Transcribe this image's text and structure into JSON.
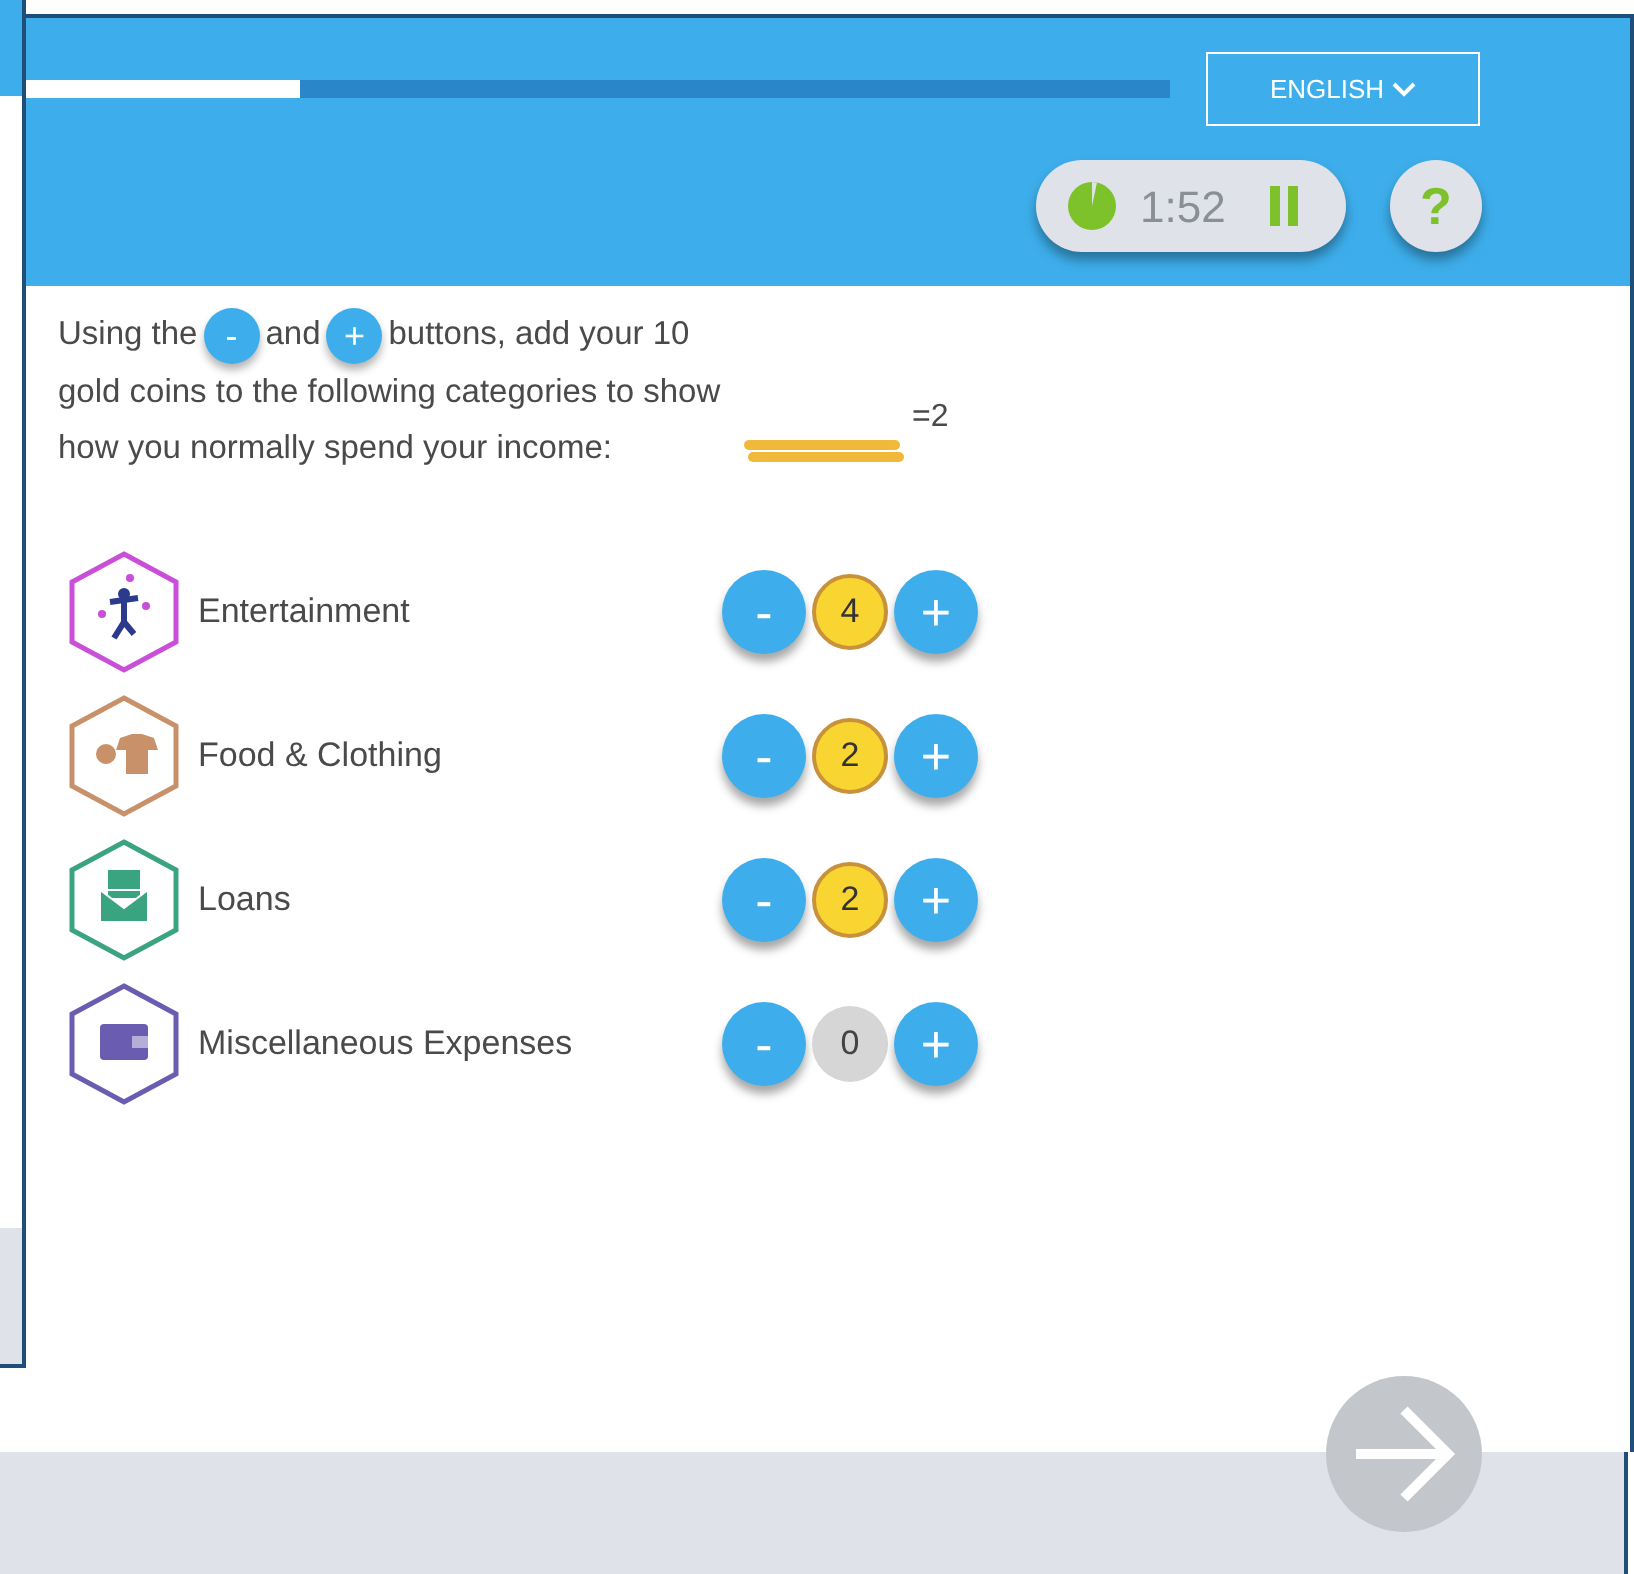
{
  "progress": {
    "level": 0.24
  },
  "language_button": {
    "label": "ENGLISH"
  },
  "timer": {
    "time": "1:52"
  },
  "help_button": {
    "label": "?"
  },
  "instructions": {
    "before": "Using the",
    "minus": "-",
    "middle": "and",
    "plus": "+",
    "after": "buttons, add your 10 gold coins to the following categories to show how you normally spend your income:"
  },
  "legend": {
    "value": "=2"
  },
  "categories": [
    {
      "kind": "entertainment",
      "label": "Entertainment",
      "color": "#c94fd8",
      "minus": "-",
      "count": "4",
      "plus": "+",
      "has_coins": true
    },
    {
      "kind": "food",
      "label": "Food & Clothing",
      "color": "#c8916a",
      "minus": "-",
      "count": "2",
      "plus": "+",
      "has_coins": true
    },
    {
      "kind": "loans",
      "label": "Loans",
      "color": "#3aa37f",
      "minus": "-",
      "count": "2",
      "plus": "+",
      "has_coins": true
    },
    {
      "kind": "wallet",
      "label": "Miscellaneous Expenses",
      "color": "#6a5cb0",
      "minus": "-",
      "count": "0",
      "plus": "+",
      "has_coins": false
    }
  ]
}
